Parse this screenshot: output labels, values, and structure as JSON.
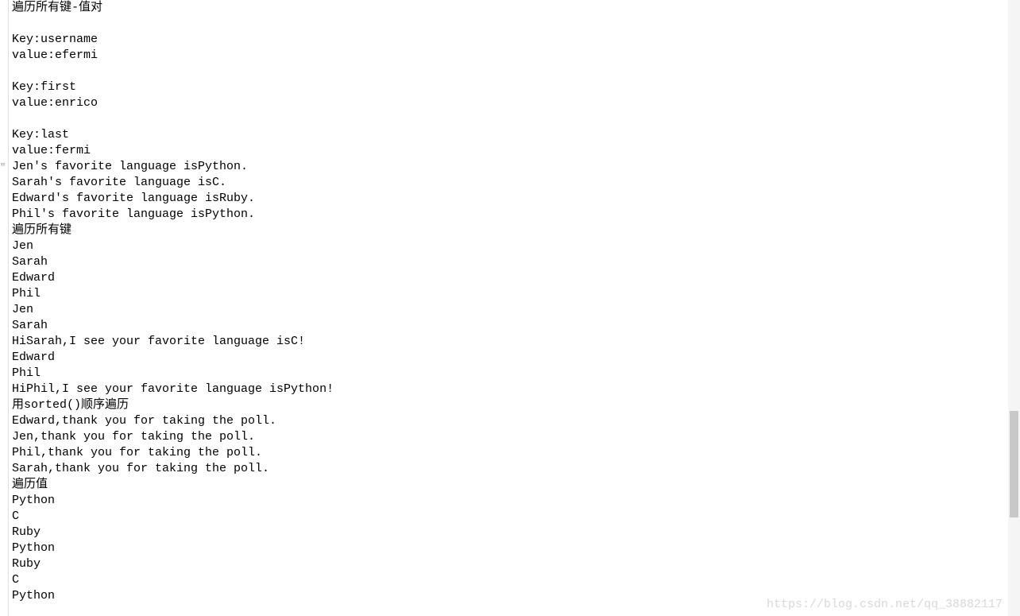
{
  "left_marker": "",
  "left_quote": "\"",
  "watermark": "https://blog.csdn.net/qq_38882117",
  "lines": [
    "遍历所有键-值对",
    "",
    "Key:username",
    "value:efermi",
    "",
    "Key:first",
    "value:enrico",
    "",
    "Key:last",
    "value:fermi",
    "Jen's favorite language isPython.",
    "Sarah's favorite language isC.",
    "Edward's favorite language isRuby.",
    "Phil's favorite language isPython.",
    "遍历所有键",
    "Jen",
    "Sarah",
    "Edward",
    "Phil",
    "Jen",
    "Sarah",
    "HiSarah,I see your favorite language isC!",
    "Edward",
    "Phil",
    "HiPhil,I see your favorite language isPython!",
    "用sorted()顺序遍历",
    "Edward,thank you for taking the poll.",
    "Jen,thank you for taking the poll.",
    "Phil,thank you for taking the poll.",
    "Sarah,thank you for taking the poll.",
    "遍历值",
    "Python",
    "C",
    "Ruby",
    "Python",
    "Ruby",
    "C",
    "Python"
  ]
}
